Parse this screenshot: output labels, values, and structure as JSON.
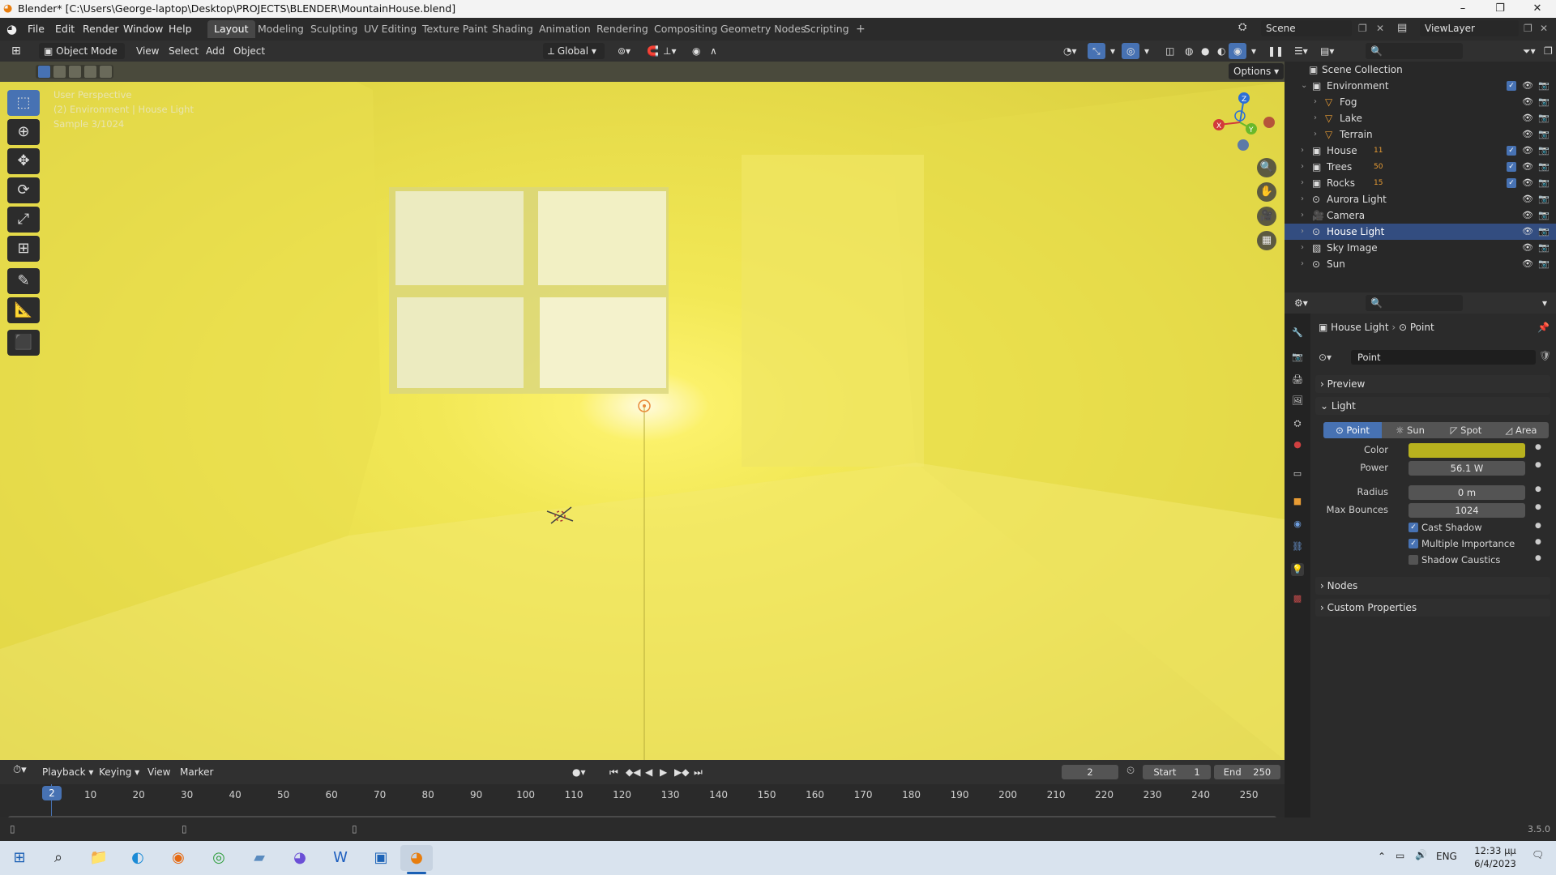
{
  "titlebar": {
    "title": "Blender* [C:\\Users\\George-laptop\\Desktop\\PROJECTS\\BLENDER\\MountainHouse.blend]",
    "minimize": "–",
    "maximize": "❐",
    "close": "✕"
  },
  "menus": [
    "File",
    "Edit",
    "Render",
    "Window",
    "Help"
  ],
  "workspace_tabs": [
    "Layout",
    "Modeling",
    "Sculpting",
    "UV Editing",
    "Texture Paint",
    "Shading",
    "Animation",
    "Rendering",
    "Compositing",
    "Geometry Nodes",
    "Scripting"
  ],
  "workspace_add": "+",
  "scene_field": "Scene",
  "viewlayer_field": "ViewLayer",
  "viewport_header": {
    "mode": "Object Mode",
    "view": "View",
    "select": "Select",
    "add": "Add",
    "object": "Object",
    "transform_orientation": "Global",
    "options": "Options"
  },
  "viewport_overlay": {
    "line1": "User Perspective",
    "line2": "(2) Environment | House Light",
    "line3": "Sample 3/1024"
  },
  "gizmo": {
    "z": "Z",
    "y": "Y",
    "x": "X"
  },
  "outliner": {
    "title": "Scene Collection",
    "rows": [
      {
        "name": "Environment",
        "depth": 0
      },
      {
        "name": "Fog",
        "depth": 1
      },
      {
        "name": "Lake",
        "depth": 1
      },
      {
        "name": "Terrain",
        "depth": 1
      },
      {
        "name": "House",
        "depth": 0,
        "badge": "11"
      },
      {
        "name": "Trees",
        "depth": 0,
        "badge": "50"
      },
      {
        "name": "Rocks",
        "depth": 0,
        "badge": "15"
      },
      {
        "name": "Aurora Light",
        "depth": 0
      },
      {
        "name": "Camera",
        "depth": 0
      },
      {
        "name": "House Light",
        "depth": 0,
        "selected": true
      },
      {
        "name": "Sky Image",
        "depth": 0
      },
      {
        "name": "Sun",
        "depth": 0
      }
    ]
  },
  "properties": {
    "breadcrumb_object": "House Light",
    "breadcrumb_data": "Point",
    "datablock": "Point",
    "panel_preview": "Preview",
    "panel_light": "Light",
    "light_types": [
      "Point",
      "Sun",
      "Spot",
      "Area"
    ],
    "active_light_type": "Point",
    "color_label": "Color",
    "color_value": "#b8b21e",
    "power_label": "Power",
    "power_value": "56.1 W",
    "radius_label": "Radius",
    "radius_value": "0 m",
    "bounces_label": "Max Bounces",
    "bounces_value": "1024",
    "cast_shadow": "Cast Shadow",
    "multiple_importance": "Multiple Importance",
    "shadow_caustics": "Shadow Caustics",
    "cast_shadow_checked": true,
    "multiple_importance_checked": true,
    "shadow_caustics_checked": false,
    "panel_nodes": "Nodes",
    "panel_custom": "Custom Properties"
  },
  "timeline": {
    "playback": "Playback",
    "keying": "Keying",
    "view": "View",
    "marker": "Marker",
    "current_frame": "2",
    "start_label": "Start",
    "start_value": "1",
    "end_label": "End",
    "end_value": "250",
    "ticks": [
      "10",
      "20",
      "30",
      "40",
      "50",
      "60",
      "70",
      "80",
      "90",
      "100",
      "110",
      "120",
      "130",
      "140",
      "150",
      "160",
      "170",
      "180",
      "190",
      "200",
      "210",
      "220",
      "230",
      "240",
      "250"
    ]
  },
  "version": "3.5.0",
  "taskbar": {
    "language": "ENG",
    "time": "12:33 μμ",
    "date": "6/4/2023"
  },
  "colors": {
    "accent": "#4772b3",
    "selected_row": "#334d80",
    "viewport_light": "#f2e856"
  }
}
